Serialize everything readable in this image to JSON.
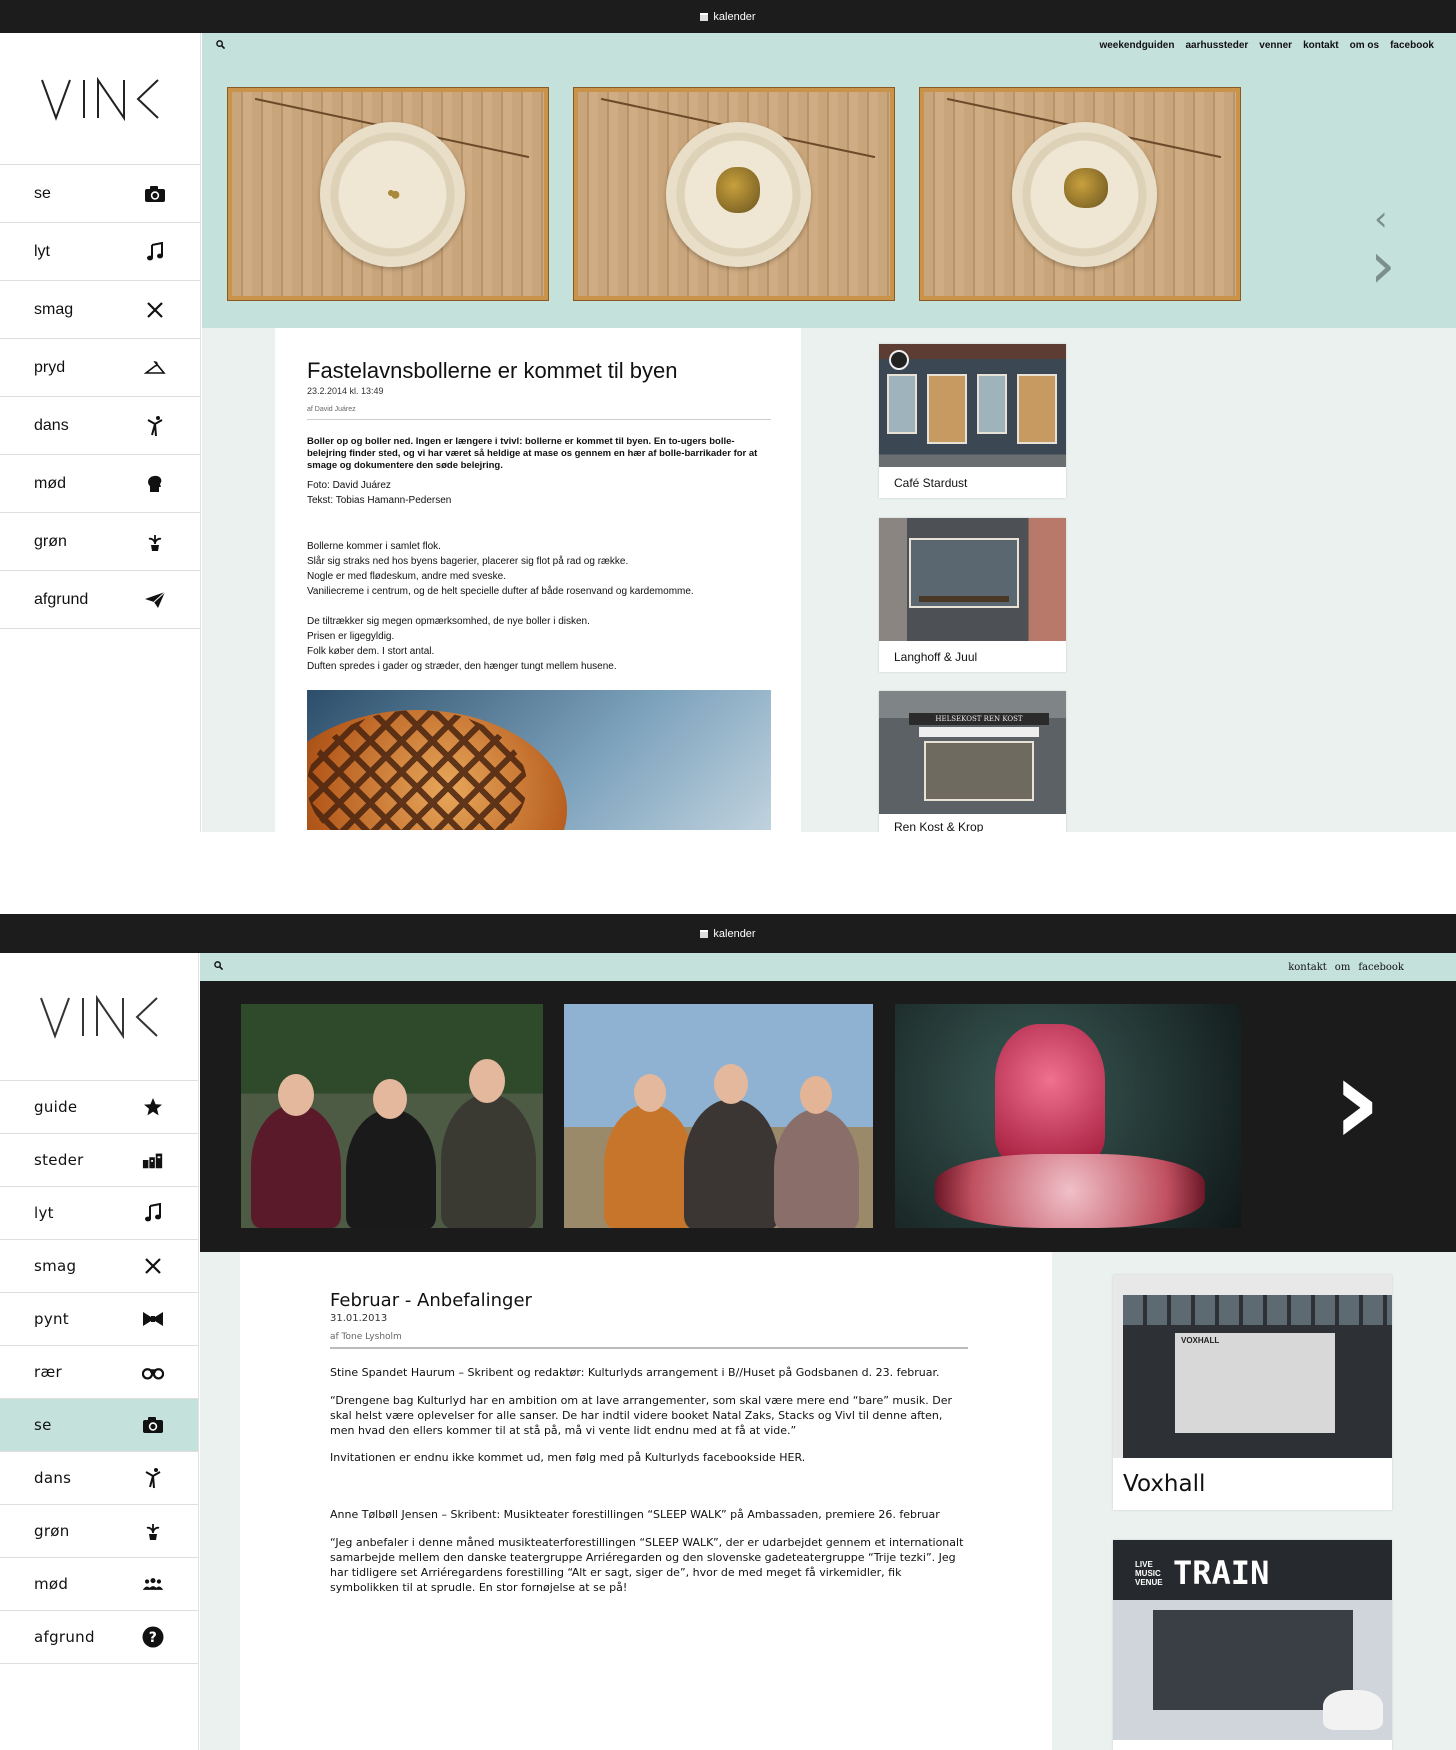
{
  "s1": {
    "topbar": {
      "label": "kalender"
    },
    "logo": "VINK",
    "nav": [
      {
        "label": "se",
        "icon": "camera-icon"
      },
      {
        "label": "lyt",
        "icon": "music-note-icon"
      },
      {
        "label": "smag",
        "icon": "fork-knife-icon"
      },
      {
        "label": "pryd",
        "icon": "hanger-icon"
      },
      {
        "label": "dans",
        "icon": "dancer-icon"
      },
      {
        "label": "mød",
        "icon": "head-icon"
      },
      {
        "label": "grøn",
        "icon": "plant-icon"
      },
      {
        "label": "afgrund",
        "icon": "paper-plane-icon"
      }
    ],
    "links": [
      "weekendguiden",
      "aarhussteder",
      "venner",
      "kontakt",
      "om os",
      "facebook"
    ],
    "article": {
      "title": "Fastelavnsbollerne er kommet til byen",
      "meta": "23.2.2014  kl. 13:49",
      "by": "af David Juárez",
      "intro": "Boller op og boller ned. Ingen er længere i tvivl: bollerne er kommet til byen. En to-ugers bolle-belejring finder sted, og vi har været så heldige at mase os gennem en hær af bolle-barrikader for at smage og dokumentere den søde belejring.",
      "credits": [
        "Foto: David Juárez",
        "Tekst: Tobias Hamann-Pedersen"
      ],
      "para1": [
        "Bollerne kommer i samlet flok.",
        "Slår sig straks ned hos byens bagerier, placerer sig flot på rad og række.",
        "Nogle er med flødeskum, andre med sveske.",
        "Vaniliecreme i centrum, og de helt specielle dufter af både rosenvand og kardemomme."
      ],
      "para2": [
        "De tiltrækker sig megen opmærksomhed, de nye boller i disken.",
        "Prisen er ligegyldig.",
        "Folk køber dem. I stort antal.",
        "Duften spredes i gader og stræder, den hænger tungt mellem husene."
      ]
    },
    "cards": [
      "Café Stardust",
      "Langhoff & Juul",
      "Ren Kost & Krop"
    ],
    "shop_sign": "HELSEKOST REN KOST"
  },
  "s2": {
    "topbar": {
      "label": "kalender"
    },
    "logo": "VINK",
    "nav": [
      {
        "label": "guide",
        "icon": "star-icon"
      },
      {
        "label": "steder",
        "icon": "buildings-icon"
      },
      {
        "label": "lyt",
        "icon": "music-note-icon"
      },
      {
        "label": "smag",
        "icon": "fork-knife-icon"
      },
      {
        "label": "pynt",
        "icon": "bow-tie-icon"
      },
      {
        "label": "rær",
        "icon": "binoculars-icon"
      },
      {
        "label": "se",
        "icon": "camera-icon",
        "active": true
      },
      {
        "label": "dans",
        "icon": "dancer-icon"
      },
      {
        "label": "grøn",
        "icon": "plant-icon"
      },
      {
        "label": "mød",
        "icon": "people-icon"
      },
      {
        "label": "afgrund",
        "icon": "question-icon"
      }
    ],
    "links": [
      "kontakt",
      "om",
      "facebook"
    ],
    "article": {
      "title": "Februar - Anbefalinger",
      "meta": "31.01.2013",
      "by": "af Tone Lysholm",
      "p1": "Stine Spandet Haurum – Skribent og redaktør: Kulturlyds arrangement i B//Huset på Godsbanen d. 23. februar.",
      "p2": "“Drengene bag Kulturlyd har en ambition om at lave arrangementer, som skal være mere end “bare” musik. Der skal helst være oplevelser for alle sanser. De har indtil videre booket Natal Zaks, Stacks og Vivl til denne aften, men hvad den ellers kommer til at stå på, må vi vente lidt endnu med at få at vide.”",
      "p3": "Invitationen er endnu ikke kommet ud, men følg med på Kulturlyds facebookside HER.",
      "p4": "Anne Tølbøll Jensen – Skribent: Musikteater forestillingen “SLEEP WALK” på Ambassaden, premiere 26. februar",
      "p5": "“Jeg anbefaler i denne måned musikteaterforestillingen “SLEEP WALK”, der er udarbejdet gennem et internationalt samarbejde mellem den danske teatergruppe Arriéregarden og den slovenske gadeteatergruppe “Trije tezki”. Jeg har tidligere set Arriéregardens forestilling “Alt er sagt, siger de”, hvor de med meget få virkemidler, fik symbolikken til at sprudle. En stor fornøjelse at se på!"
    },
    "cards": [
      "Voxhall"
    ],
    "train_sign": "TRAIN",
    "train_side": "LIVE MUSIC VENUE",
    "voxhall_sign": "VOXHALL"
  },
  "colors": {
    "topbar": "#1c1c1c",
    "mint": "#c4e1dc",
    "bg": "#eaf1ee",
    "active": "#c4e1dc"
  }
}
